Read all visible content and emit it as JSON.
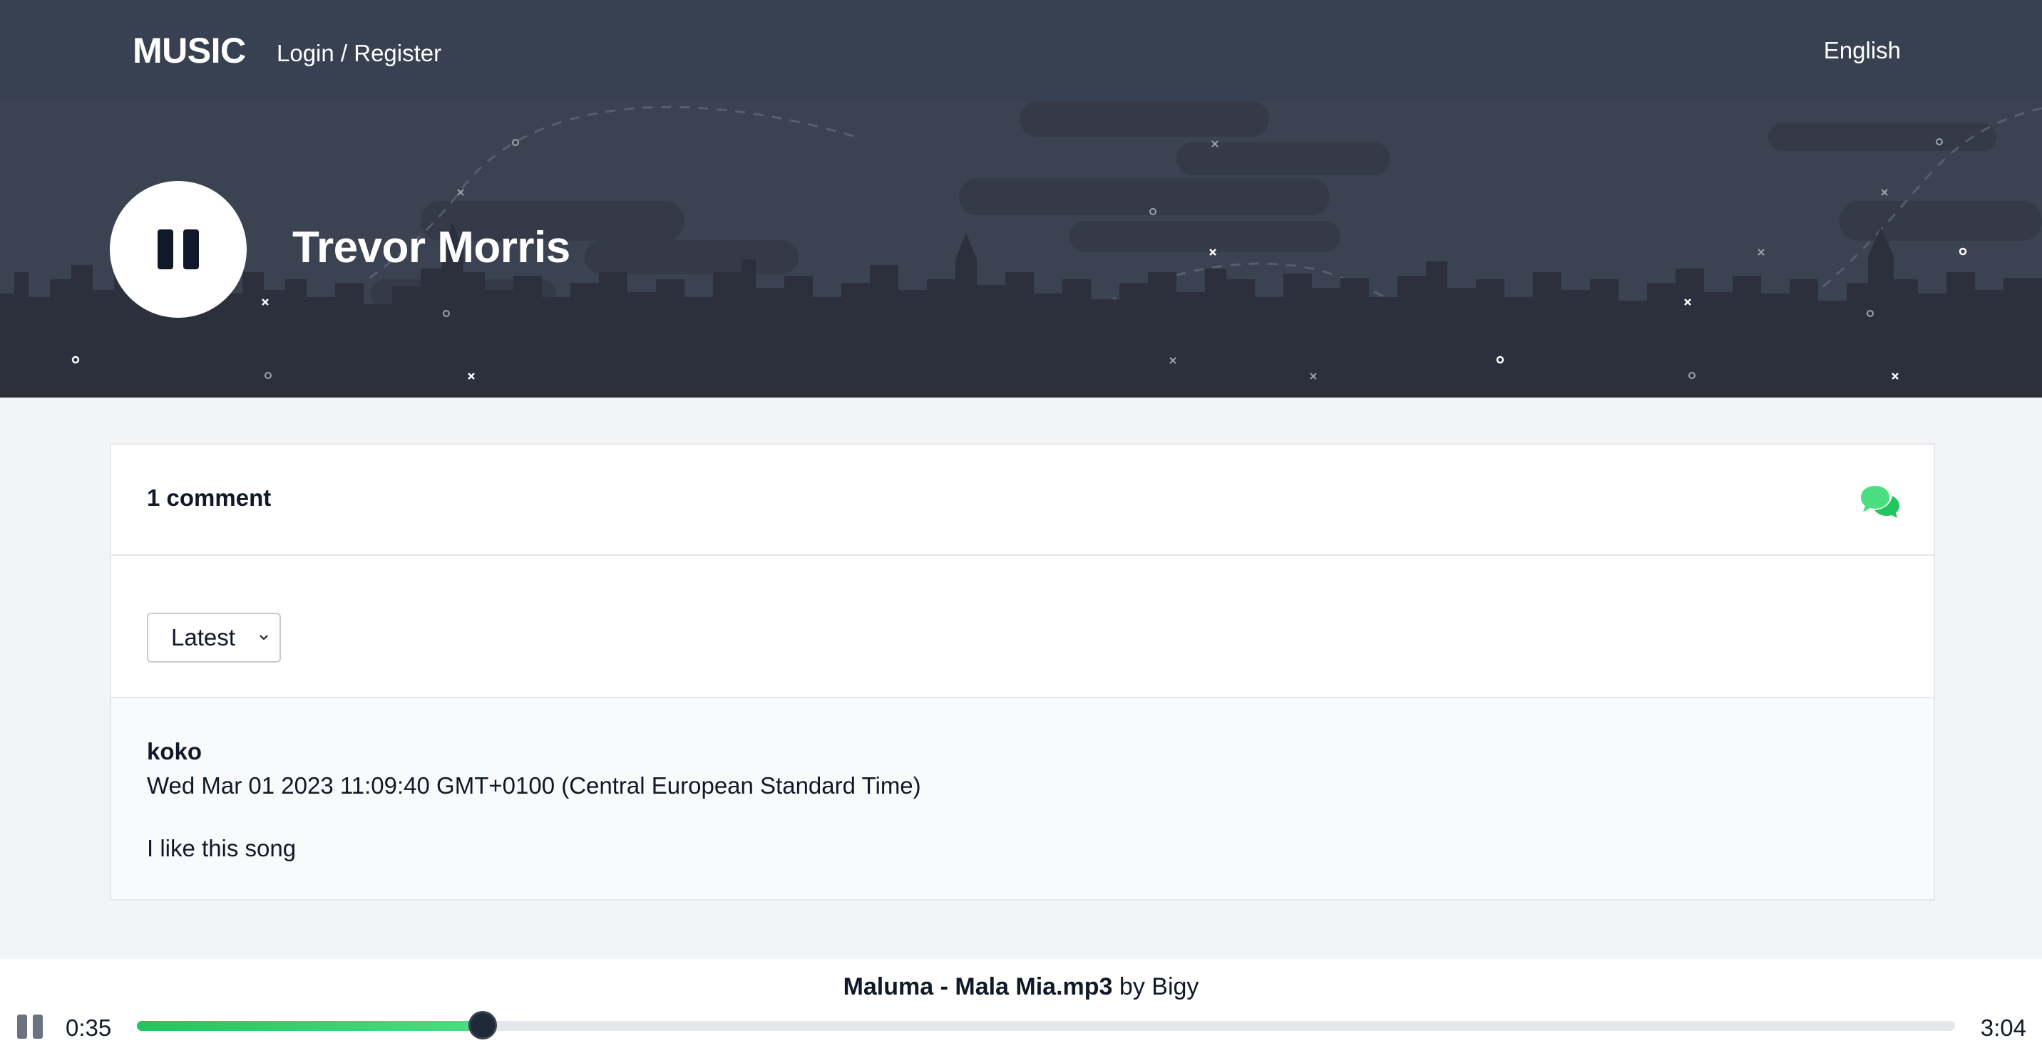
{
  "header": {
    "brand": "MUSIC",
    "auth_link": "Login / Register",
    "language": "English"
  },
  "hero": {
    "artist": "Trevor Morris",
    "play_state_icon": "pause-icon"
  },
  "comments": {
    "count_label": "1 comment",
    "icon": "chat-bubbles-icon",
    "sort": {
      "selected": "Latest"
    },
    "items": [
      {
        "author": "koko",
        "date": "Wed Mar 01 2023 11:09:40 GMT+0100 (Central European Standard Time)",
        "text": "I like this song"
      }
    ]
  },
  "player": {
    "track": "Maluma - Mala Mia.mp3",
    "by_label": "by",
    "artist": "Bigy",
    "current_time": "0:35",
    "total_time": "3:04",
    "progress": 0.19
  },
  "colors": {
    "header_bg": "#374151",
    "accent": "#22c55e",
    "page_bg": "#f3f4f6"
  }
}
